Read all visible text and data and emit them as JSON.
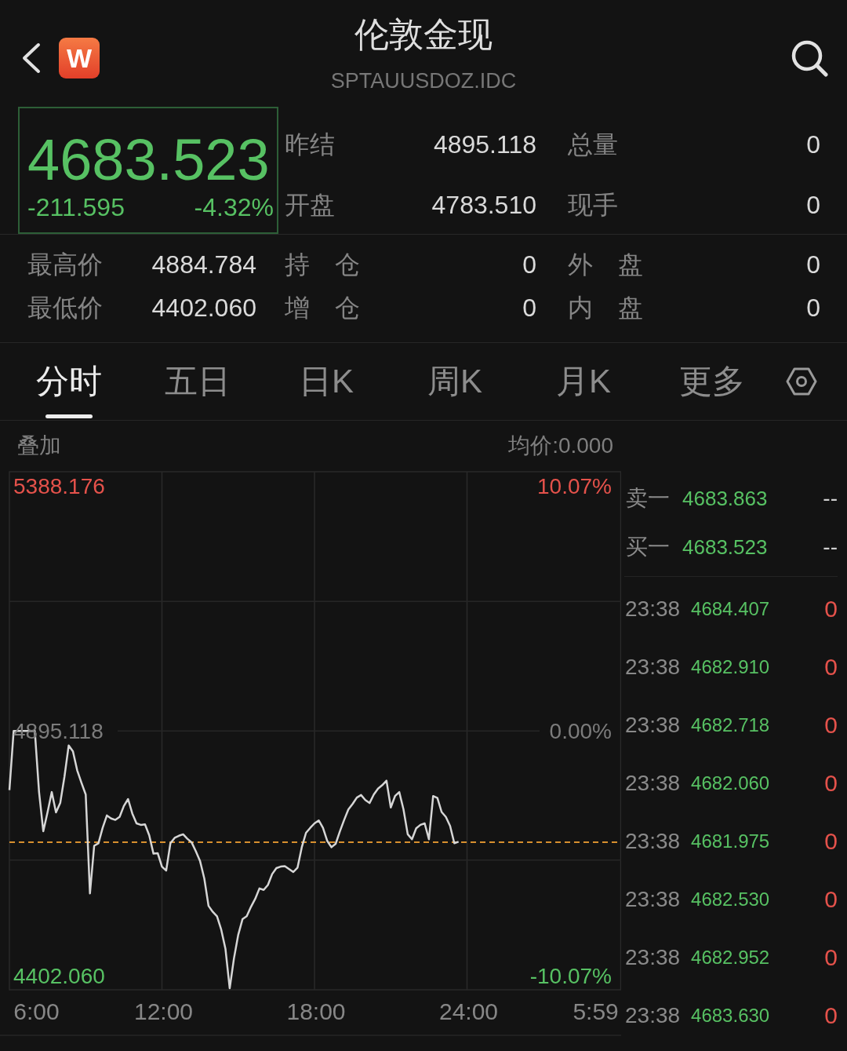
{
  "header": {
    "title": "伦敦金现",
    "subtitle": "SPTAUUSDOZ.IDC",
    "logo": "W"
  },
  "quote": {
    "price": "4683.523",
    "change": "-211.595",
    "change_pct": "-4.32%",
    "stats": [
      {
        "label": "昨结",
        "value": "4895.118"
      },
      {
        "label": "总量",
        "value": "0"
      },
      {
        "label": "开盘",
        "value": "4783.510"
      },
      {
        "label": "现手",
        "value": "0"
      }
    ]
  },
  "details": [
    {
      "label": "最高价",
      "value": "4884.784"
    },
    {
      "label": "持 仓",
      "value": "0"
    },
    {
      "label": "外 盘",
      "value": "0"
    },
    {
      "label": "最低价",
      "value": "4402.060"
    },
    {
      "label": "增 仓",
      "value": "0"
    },
    {
      "label": "内 盘",
      "value": "0"
    }
  ],
  "tabs": [
    {
      "label": "分时",
      "selected": true
    },
    {
      "label": "五日",
      "selected": false
    },
    {
      "label": "日K",
      "selected": false
    },
    {
      "label": "周K",
      "selected": false
    },
    {
      "label": "月K",
      "selected": false
    },
    {
      "label": "更多",
      "selected": false
    }
  ],
  "chart": {
    "overlay_label": "叠加",
    "avg_price": "均价:0.000",
    "right_labels": [
      "10.07%",
      "0.00%",
      "-10.07%"
    ],
    "chart_data": {
      "type": "line",
      "ylim": [
        4374,
        5417
      ],
      "yticks": [
        {
          "value": 4402.06,
          "label": "4402.060"
        },
        {
          "value": 4895.118,
          "label": "4895.118"
        },
        {
          "value": 5388.176,
          "label": "5388.176"
        }
      ],
      "ref_lines": [
        {
          "axis": "y",
          "value": 5156,
          "color": "#262626"
        },
        {
          "axis": "y",
          "value": 4635,
          "color": "#262626"
        },
        {
          "axis": "y",
          "value": 4671,
          "color": "#d8902e"
        }
      ],
      "categories": [
        null,
        null,
        null,
        null,
        null,
        null,
        "6:00",
        null,
        null,
        null,
        null,
        null,
        null,
        null,
        null,
        null,
        null,
        null,
        null,
        null,
        null,
        null,
        null,
        null,
        null,
        null,
        null,
        null,
        null,
        null,
        null,
        null,
        null,
        null,
        null,
        null,
        "12:00",
        null,
        null,
        null,
        null,
        null,
        null,
        null,
        null,
        null,
        null,
        null,
        null,
        null,
        null,
        null,
        null,
        null,
        null,
        null,
        null,
        null,
        null,
        null,
        null,
        null,
        null,
        null,
        null,
        null,
        null,
        null,
        null,
        null,
        null,
        null,
        "18:00",
        null,
        null,
        null,
        null,
        null,
        null,
        null,
        null,
        null,
        null,
        null,
        null,
        null,
        null,
        null,
        null,
        null,
        null,
        null,
        null,
        null,
        null,
        null,
        null,
        null,
        null,
        null,
        null,
        null,
        null,
        null,
        null,
        null,
        null,
        null,
        "24:00",
        null,
        null,
        null,
        null,
        null,
        null,
        null,
        null,
        null,
        null,
        null,
        null,
        null,
        null,
        null,
        null,
        null,
        null,
        null,
        null,
        null,
        null,
        null,
        null,
        null,
        null,
        null,
        null,
        null,
        "5:59",
        null,
        null,
        null,
        null,
        null
      ],
      "series": [
        {
          "color": "#d6d6d6",
          "values": [
            4776,
            4895,
            4895,
            4895,
            4895,
            4895,
            4895,
            4772,
            4693,
            4731,
            4772,
            4731,
            4750,
            4803,
            4866,
            4854,
            4816,
            4791,
            4767,
            4568,
            4664,
            4669,
            4700,
            4725,
            4719,
            4716,
            4722,
            4744,
            4758,
            4729,
            4709,
            4706,
            4707,
            4685,
            4648,
            4649,
            4622,
            4614,
            4669,
            4680,
            4684,
            4687,
            4678,
            4671,
            4653,
            4633,
            4598,
            4543,
            4531,
            4522,
            4495,
            4456,
            4377,
            4437,
            4485,
            4516,
            4522,
            4541,
            4557,
            4578,
            4575,
            4585,
            4607,
            4619,
            4622,
            4623,
            4617,
            4611,
            4620,
            4661,
            4690,
            4700,
            4709,
            4715,
            4700,
            4674,
            4661,
            4668,
            4693,
            4716,
            4737,
            4748,
            4761,
            4766,
            4756,
            4750,
            4767,
            4779,
            4786,
            4795,
            4741,
            4764,
            4772,
            4737,
            4687,
            4677,
            4699,
            4706,
            4709,
            4677,
            4764,
            4760,
            4732,
            4722,
            4704,
            4669,
            4672,
            null,
            null,
            null,
            null,
            null,
            null,
            null,
            null,
            null,
            null,
            null,
            null,
            null,
            null,
            null,
            null,
            null,
            null,
            null,
            null,
            null,
            null,
            null,
            null,
            null,
            null,
            null,
            null,
            null,
            null,
            null,
            null,
            null,
            null,
            null,
            null,
            null
          ]
        }
      ]
    }
  },
  "order_book": [
    {
      "label": "卖一",
      "price": "4683.863",
      "volume": "--"
    },
    {
      "label": "买一",
      "price": "4683.523",
      "volume": "--"
    }
  ],
  "ticks": [
    {
      "time": "23:38",
      "price": "4684.407",
      "volume": "0"
    },
    {
      "time": "23:38",
      "price": "4682.910",
      "volume": "0"
    },
    {
      "time": "23:38",
      "price": "4682.718",
      "volume": "0"
    },
    {
      "time": "23:38",
      "price": "4682.060",
      "volume": "0"
    },
    {
      "time": "23:38",
      "price": "4681.975",
      "volume": "0"
    },
    {
      "time": "23:38",
      "price": "4682.530",
      "volume": "0"
    },
    {
      "time": "23:38",
      "price": "4682.952",
      "volume": "0"
    },
    {
      "time": "23:38",
      "price": "4683.630",
      "volume": "0"
    }
  ]
}
